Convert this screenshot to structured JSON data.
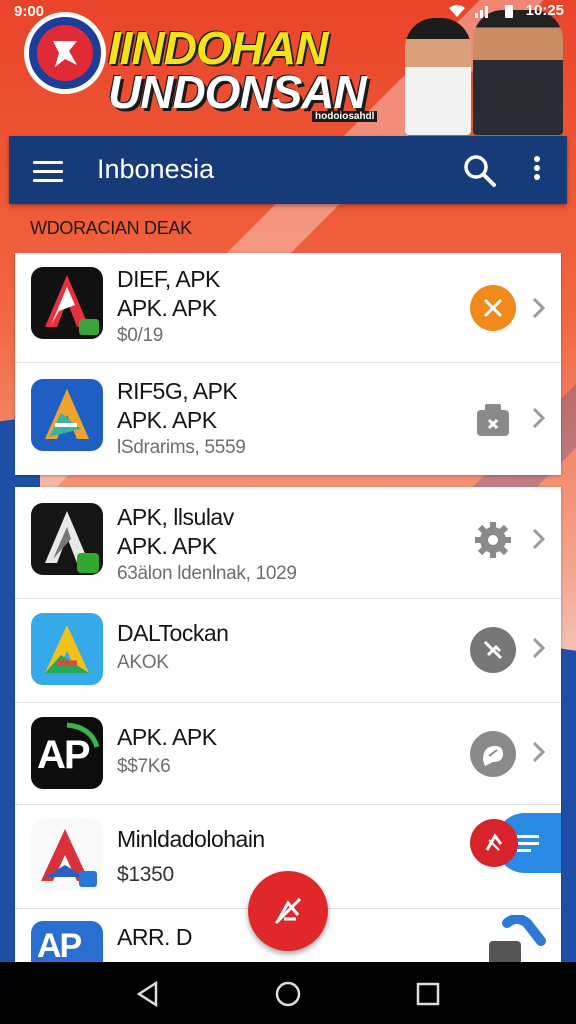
{
  "status": {
    "time": "9:00",
    "right": "10:25"
  },
  "banner": {
    "line1": "IINDOHAN",
    "line2": "UNDONSAN",
    "sub": "hodoiosahdl"
  },
  "toolbar": {
    "title": "Inbonesia"
  },
  "section": {
    "label": "WDORACIAN DEAK"
  },
  "group1": [
    {
      "t1": "DIEF, APK",
      "t2": "APK. APK",
      "t3": "$0/19",
      "action_icon": "close-icon",
      "action_color": "#f08a1c"
    },
    {
      "t1": "RIF5G, APK",
      "t2": "APK. APK",
      "t3": "lSdrarims, 5559",
      "action_icon": "package-icon",
      "action_color": "#8a8a8a"
    }
  ],
  "group2": [
    {
      "t1": "APK, llsulav",
      "t2": "APK. APK",
      "t3": "63älon ldenlnak, 1029",
      "action_icon": "gear-icon",
      "action_color": "#8a8a8a"
    },
    {
      "t1": "DALTockan",
      "t2": "",
      "t3": "AKOK",
      "action_icon": "unlink-icon",
      "action_color": "#777777"
    },
    {
      "t1": "APK. APK",
      "t2": "",
      "t3": "$$7K6",
      "action_icon": "chat-icon",
      "action_color": "#8a8a8a"
    },
    {
      "t1": "Minldadolohain",
      "t2": "",
      "t3": "$1350",
      "action_icon": "list-icon",
      "action_color": "#2a8ae6"
    },
    {
      "t1": "ARR. D",
      "t2": "",
      "t3": "",
      "action_icon": "tools-icon",
      "action_color": "#2a7ad6"
    }
  ],
  "app_icons": {
    "app1": {
      "text": "AP"
    },
    "app5": {
      "text": "AP"
    },
    "app7": {
      "text": "AP"
    }
  },
  "colors": {
    "toolbar": "#173a78",
    "fab": "#e0282a",
    "accent_orange": "#f08a1c"
  }
}
